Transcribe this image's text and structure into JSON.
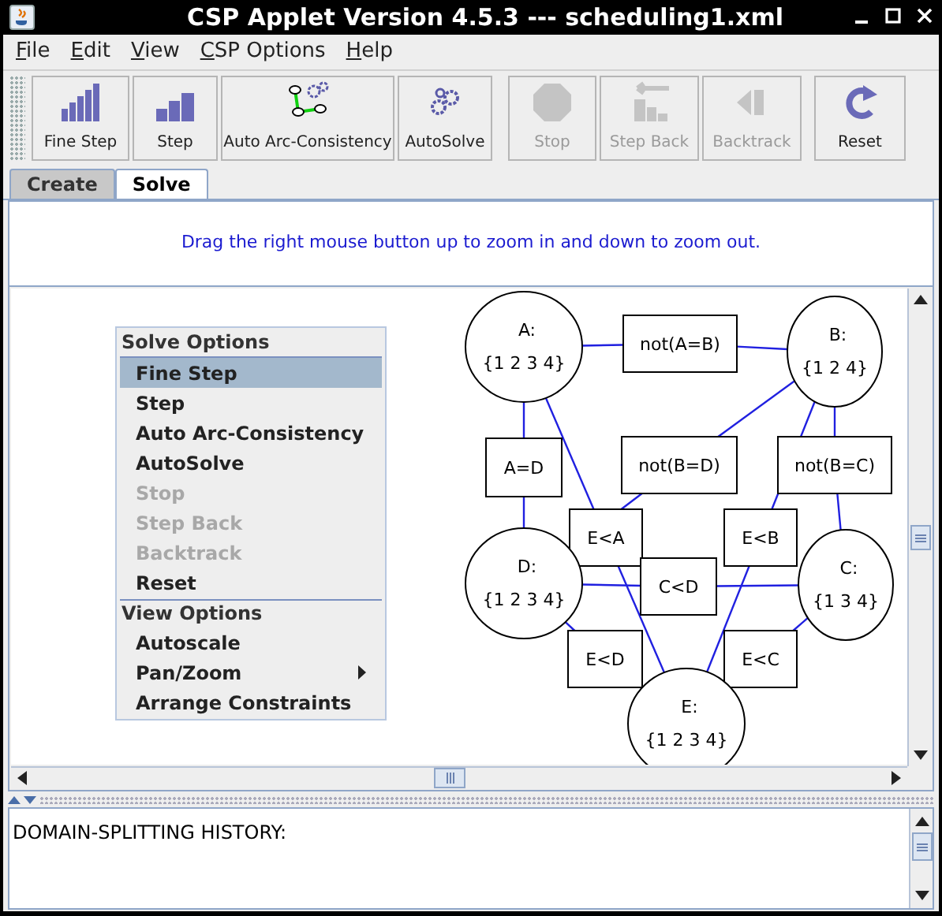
{
  "window": {
    "title": "CSP Applet Version 4.5.3 --- scheduling1.xml"
  },
  "menu_bar": [
    {
      "label": "File",
      "mnemonic_underlined": true
    },
    {
      "label": "Edit",
      "mnemonic_underlined": true
    },
    {
      "label": "View",
      "mnemonic_underlined": true
    },
    {
      "label": "CSP Options",
      "mnemonic_underlined": true
    },
    {
      "label": "Help",
      "mnemonic_underlined": true
    }
  ],
  "toolbar": [
    {
      "kind": "fine_step",
      "label": "Fine Step",
      "disabled": false
    },
    {
      "kind": "step",
      "label": "Step",
      "disabled": false
    },
    {
      "kind": "arc",
      "label": "Auto Arc-Consistency",
      "disabled": false
    },
    {
      "kind": "solve",
      "label": "AutoSolve",
      "disabled": false
    },
    {
      "kind": "stop",
      "label": "Stop",
      "disabled": true
    },
    {
      "kind": "step_back",
      "label": "Step Back",
      "disabled": true
    },
    {
      "kind": "backtrack",
      "label": "Backtrack",
      "disabled": true
    },
    {
      "kind": "reset",
      "label": "Reset",
      "disabled": false
    }
  ],
  "tabs": [
    {
      "label": "Create",
      "selected": false
    },
    {
      "label": "Solve",
      "selected": true
    }
  ],
  "message": "Drag the right mouse button up to zoom in and down to zoom out.",
  "graph": {
    "variables": [
      {
        "name": "A:",
        "domain": "{1 2 3 4}"
      },
      {
        "name": "B:",
        "domain": "{1 2 4}"
      },
      {
        "name": "D:",
        "domain": "{1 2 3 4}"
      },
      {
        "name": "C:",
        "domain": "{1 3 4}"
      },
      {
        "name": "E:",
        "domain": "{1 2 3 4}"
      }
    ],
    "constraints": [
      {
        "label": "not(A=B)"
      },
      {
        "label": "A=D"
      },
      {
        "label": "not(B=D)"
      },
      {
        "label": "not(B=C)"
      },
      {
        "label": "E<A"
      },
      {
        "label": "E<B"
      },
      {
        "label": "C<D"
      },
      {
        "label": "E<D"
      },
      {
        "label": "E<C"
      }
    ]
  },
  "popup_menu": {
    "sections": [
      {
        "title": "Solve Options",
        "items": [
          {
            "label": "Fine Step",
            "disabled": false,
            "selected": true,
            "submenu": false
          },
          {
            "label": "Step",
            "disabled": false,
            "selected": false,
            "submenu": false
          },
          {
            "label": "Auto Arc-Consistency",
            "disabled": false,
            "selected": false,
            "submenu": false
          },
          {
            "label": "AutoSolve",
            "disabled": false,
            "selected": false,
            "submenu": false
          },
          {
            "label": "Stop",
            "disabled": true,
            "selected": false,
            "submenu": false
          },
          {
            "label": "Step Back",
            "disabled": true,
            "selected": false,
            "submenu": false
          },
          {
            "label": "Backtrack",
            "disabled": true,
            "selected": false,
            "submenu": false
          },
          {
            "label": "Reset",
            "disabled": false,
            "selected": false,
            "submenu": false
          }
        ]
      },
      {
        "title": "View Options",
        "items": [
          {
            "label": "Autoscale",
            "disabled": false,
            "selected": false,
            "submenu": false
          },
          {
            "label": "Pan/Zoom",
            "disabled": false,
            "selected": false,
            "submenu": true
          },
          {
            "label": "Arrange Constraints",
            "disabled": false,
            "selected": false,
            "submenu": false
          }
        ]
      }
    ]
  },
  "history": {
    "text": "DOMAIN-SPLITTING HISTORY:"
  }
}
